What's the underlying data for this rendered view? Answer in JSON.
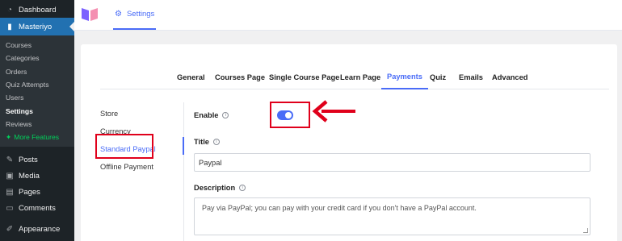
{
  "wp_sidebar": {
    "dashboard": "Dashboard",
    "masteriyo": "Masteriyo",
    "submenu": [
      "Courses",
      "Categories",
      "Orders",
      "Quiz Attempts",
      "Users",
      "Settings",
      "Reviews"
    ],
    "more_features": "More Features",
    "posts": "Posts",
    "media": "Media",
    "pages": "Pages",
    "comments": "Comments",
    "appearance": "Appearance"
  },
  "header": {
    "tab_label": "Settings"
  },
  "tabs": [
    "General",
    "Courses Page",
    "Single Course Page",
    "Learn Page",
    "Payments",
    "Quiz",
    "Emails",
    "Advanced"
  ],
  "active_tab": "Payments",
  "subnav": [
    "Store",
    "Currency",
    "Standard Paypal",
    "Offline Payment"
  ],
  "form": {
    "enable_label": "Enable",
    "enable_value": true,
    "title_label": "Title",
    "title_value": "Paypal",
    "description_label": "Description",
    "description_value": "Pay via PayPal; you can pay with your credit card if you don't have a PayPal account."
  },
  "colors": {
    "accent": "#4a6cf7",
    "wp_sidebar_bg": "#1d2327",
    "wp_active": "#2271b1",
    "annotation_red": "#e0001b",
    "more_features": "#00d25b"
  }
}
